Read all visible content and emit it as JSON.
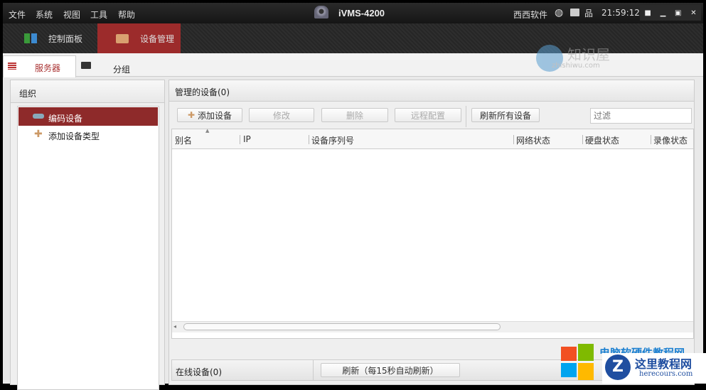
{
  "menu": [
    "文件",
    "系统",
    "视图",
    "工具",
    "帮助"
  ],
  "app_title": "iVMS-4200",
  "status": {
    "user": "西西软件",
    "time": "21:59:12"
  },
  "nav_tabs": [
    {
      "label": "控制面板"
    },
    {
      "label": "设备管理"
    }
  ],
  "sub_tabs": [
    {
      "label": "服务器"
    },
    {
      "label": "分组"
    }
  ],
  "left": {
    "header": "组织",
    "tree": [
      {
        "label": "编码设备"
      },
      {
        "label": "添加设备类型"
      }
    ]
  },
  "right": {
    "header": "管理的设备(0)",
    "toolbar": {
      "add": "添加设备",
      "modify": "修改",
      "delete": "删除",
      "remote": "远程配置",
      "refresh_all": "刷新所有设备",
      "filter_placeholder": "过滤"
    },
    "columns": [
      "别名",
      "IP",
      "设备序列号",
      "网络状态",
      "硬盘状态",
      "录像状态"
    ],
    "online_header": "在线设备(0)",
    "refresh": "刷新（每15秒自动刷新）"
  },
  "watermarks": {
    "top": "知识屋",
    "top_url": "zhishiwu.com",
    "bottom_partial": "电脑软硬件教程网",
    "bottom": "这里教程网",
    "bottom_url": "herecours.com"
  }
}
